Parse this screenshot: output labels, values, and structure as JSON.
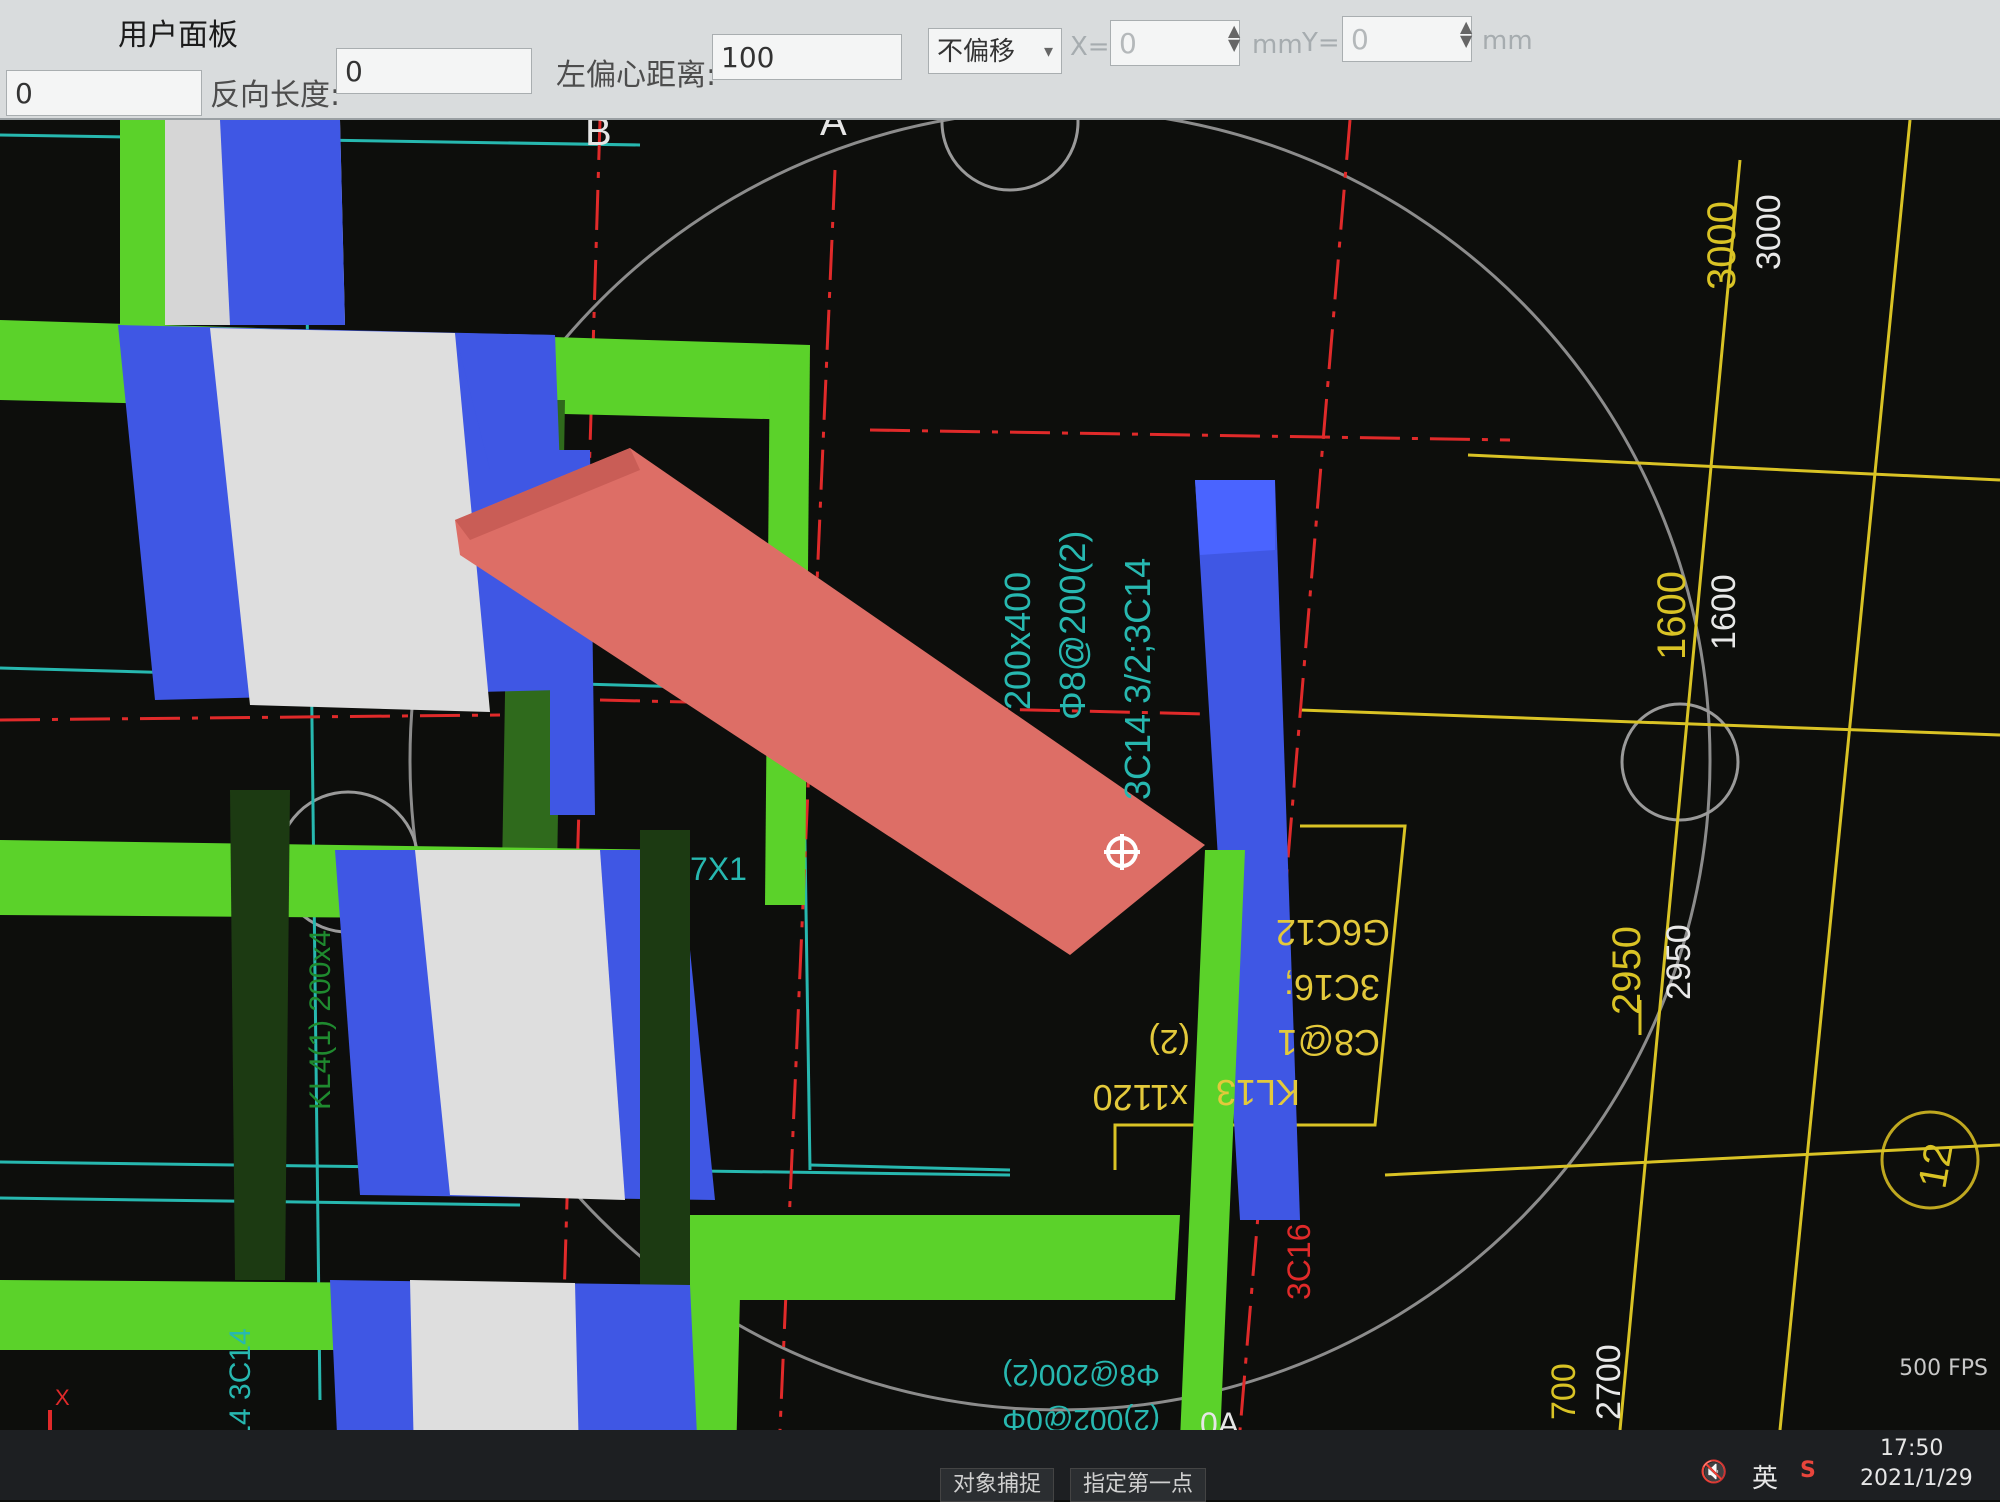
{
  "window": {
    "panel_title": "用户面板"
  },
  "toolbar": {
    "field_0_value": "0",
    "reverse_length_label": "反向长度:",
    "reverse_length_value": "0",
    "left_offset_label": "左偏心距离:",
    "left_offset_value": "100",
    "offset_mode_selected": "不偏移",
    "x_label": "X=",
    "x_value": "0",
    "x_unit": "mm",
    "y_label": "Y=",
    "y_value": "0",
    "y_unit": "mm"
  },
  "drawing": {
    "axis_labels": {
      "b": "B",
      "a": "A",
      "oa": "0A",
      "oa_bottom": "0A",
      "a_bottom": "A"
    },
    "dimensions": {
      "d3000a": "3000",
      "d3000b": "3000",
      "d1600a": "1600",
      "d1600b": "1600",
      "d2950a": "2950",
      "d2950b": "2950",
      "d2700": "2700",
      "d700": "700"
    },
    "grid_bubble": "12",
    "beam_texts": {
      "t1": "200x400",
      "t2": "Φ8@200(2)",
      "t3": "3C14 3/2;3C14",
      "y1": "KL13",
      "y2": "x1120",
      "y3": "C8@1",
      "y4": "(2)",
      "y5": "3C16;",
      "y6": "G6C12",
      "r1": "3C16",
      "m1": "7X1",
      "m2": "KL4(1) 200x4",
      "m3": "3C14 3C14",
      "m4": "(2)002@0Φ",
      "m5": "Φ8@200(2)",
      "m6": "200x400"
    }
  },
  "status": {
    "btn1": "对象捕捉",
    "btn2": "指定第一点",
    "fps": "500 FPS",
    "time": "17:50",
    "date": "2021/1/29",
    "ime": "英",
    "sound_icon": "speaker-muted-icon"
  },
  "colors": {
    "beam_green": "#5bd22a",
    "column_blue": "#3f57e4",
    "column_face": "#d6d6d6",
    "selected_beam": "#dd6e66",
    "cad_yellow": "#d9c325",
    "cad_cyan": "#27b8b0",
    "cad_red": "#e02a2a"
  }
}
